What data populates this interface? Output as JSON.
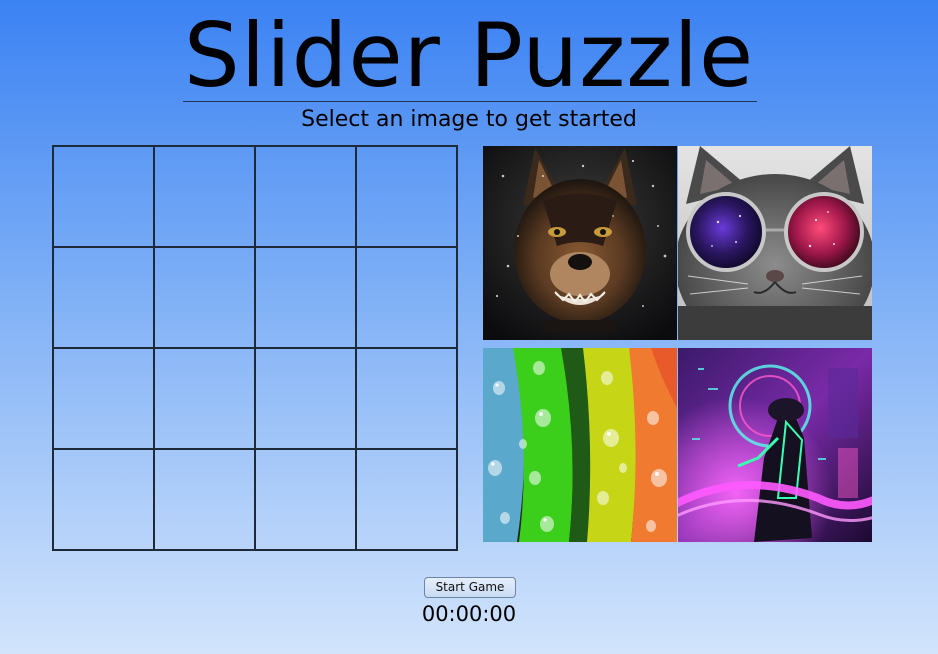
{
  "header": {
    "title": "Slider Puzzle",
    "subtitle": "Select an image to get started"
  },
  "board": {
    "rows": 4,
    "columns": 4
  },
  "gallery": {
    "images": [
      {
        "subject": "snarling dog in snow"
      },
      {
        "subject": "cat wearing galaxy sunglasses"
      },
      {
        "subject": "colorful leaves with water droplets"
      },
      {
        "subject": "neon cyberpunk figure"
      }
    ]
  },
  "controls": {
    "start_label": "Start Game",
    "timer": "00:00:00"
  }
}
